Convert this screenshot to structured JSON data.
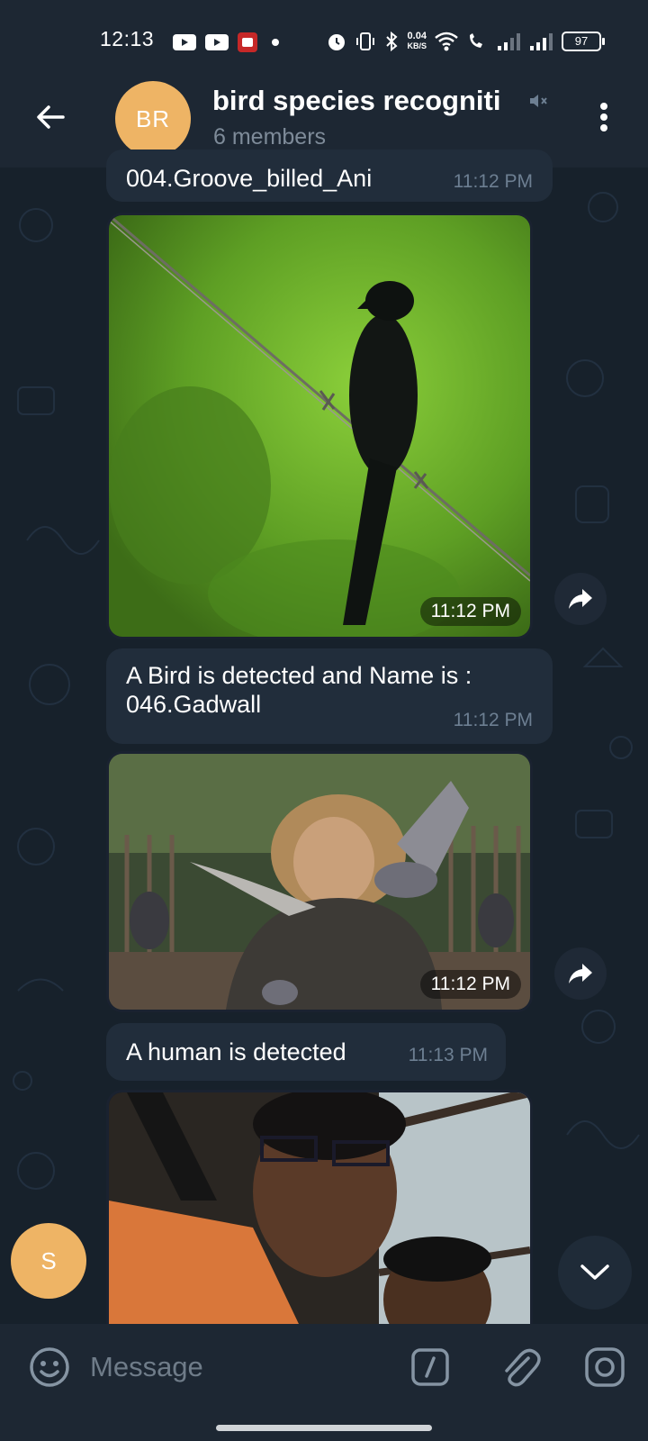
{
  "status_bar": {
    "time": "12:13",
    "net_speed_value": "0.04",
    "net_speed_unit": "KB/S",
    "battery": "97"
  },
  "header": {
    "avatar_initials": "BR",
    "title": "bird species recogniti",
    "subtitle": "6 members",
    "accent_color": "#eeb465"
  },
  "messages": [
    {
      "type": "text",
      "text": "004.Groove_billed_Ani",
      "time": "11:12 PM"
    },
    {
      "type": "photo",
      "subject": "black bird on barbed wire",
      "time": "11:12 PM"
    },
    {
      "type": "text",
      "line1": "A Bird is detected and Name is :",
      "line2": "046.Gadwall",
      "time": "11:12 PM"
    },
    {
      "type": "photo",
      "subject": "person holding pigeons",
      "time": "11:12 PM"
    },
    {
      "type": "text",
      "text": "A human is detected",
      "time": "11:13 PM"
    },
    {
      "type": "photo",
      "subject": "people selfie"
    }
  ],
  "sender_avatar": "S",
  "input": {
    "placeholder": "Message"
  },
  "icons": [
    "back-arrow-icon",
    "muted-icon",
    "more-vert-icon",
    "forward-icon",
    "chevron-down-icon",
    "emoji-icon",
    "bot-command-icon",
    "attach-icon",
    "camera-icon"
  ]
}
